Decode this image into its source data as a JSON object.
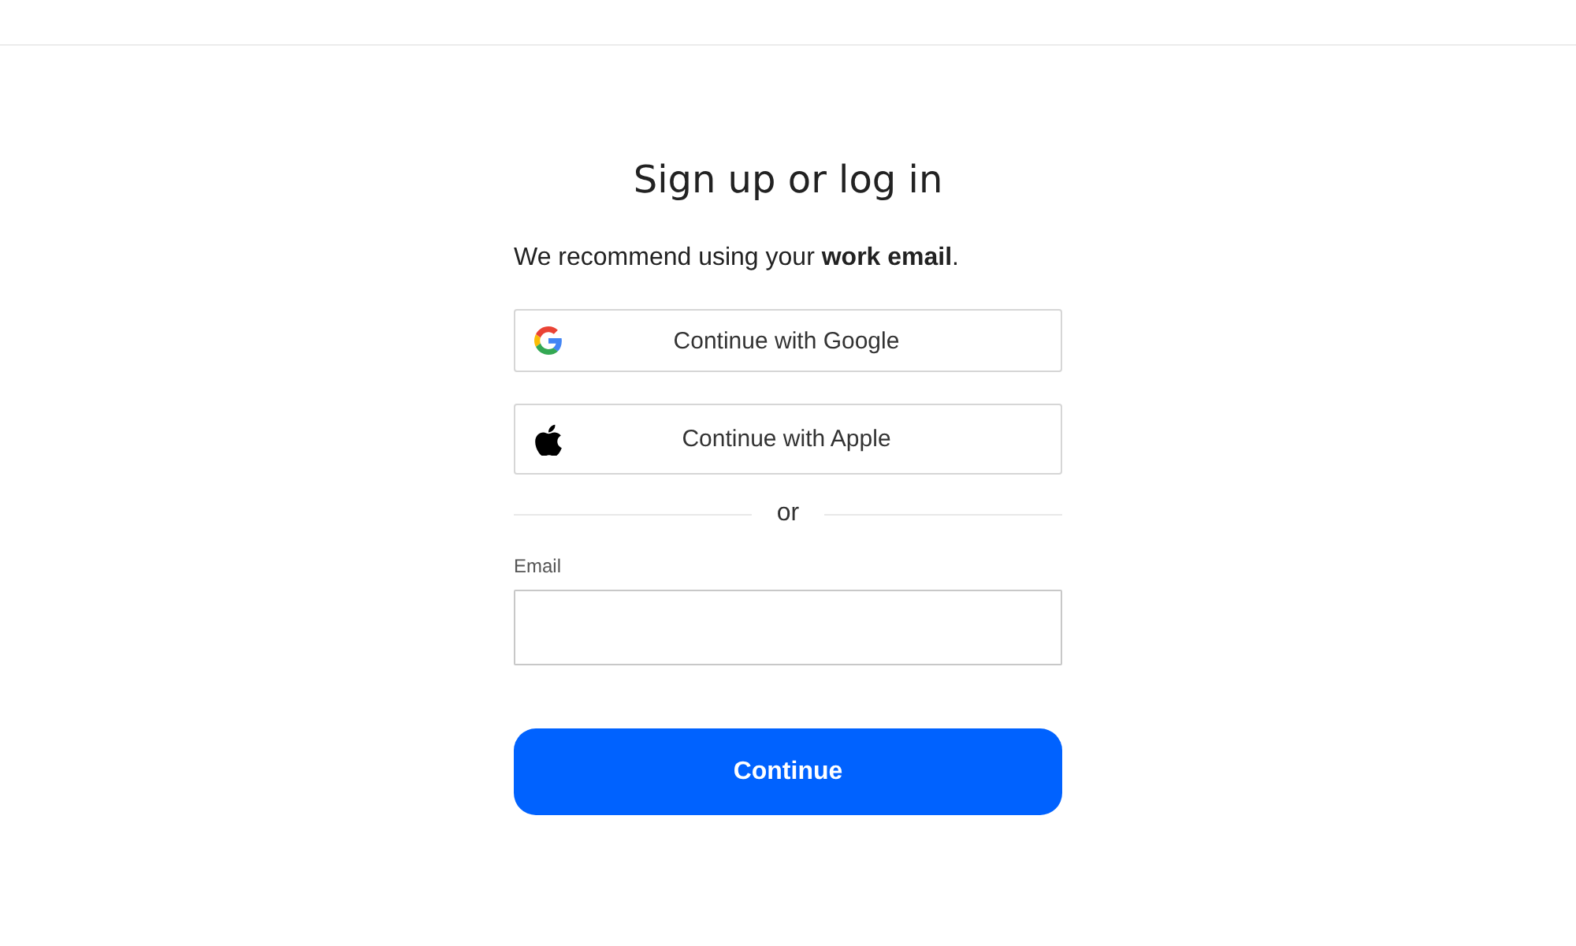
{
  "title": "Sign up or log in",
  "intro": "We recommend using your **work email**.",
  "social_buttons": [
    {
      "kind": "google",
      "label": "Continue with Google"
    },
    {
      "kind": "apple",
      "label": "Continue with Apple"
    }
  ],
  "divider": "or",
  "email": {
    "label": "Email"
  },
  "submit": "Continue"
}
